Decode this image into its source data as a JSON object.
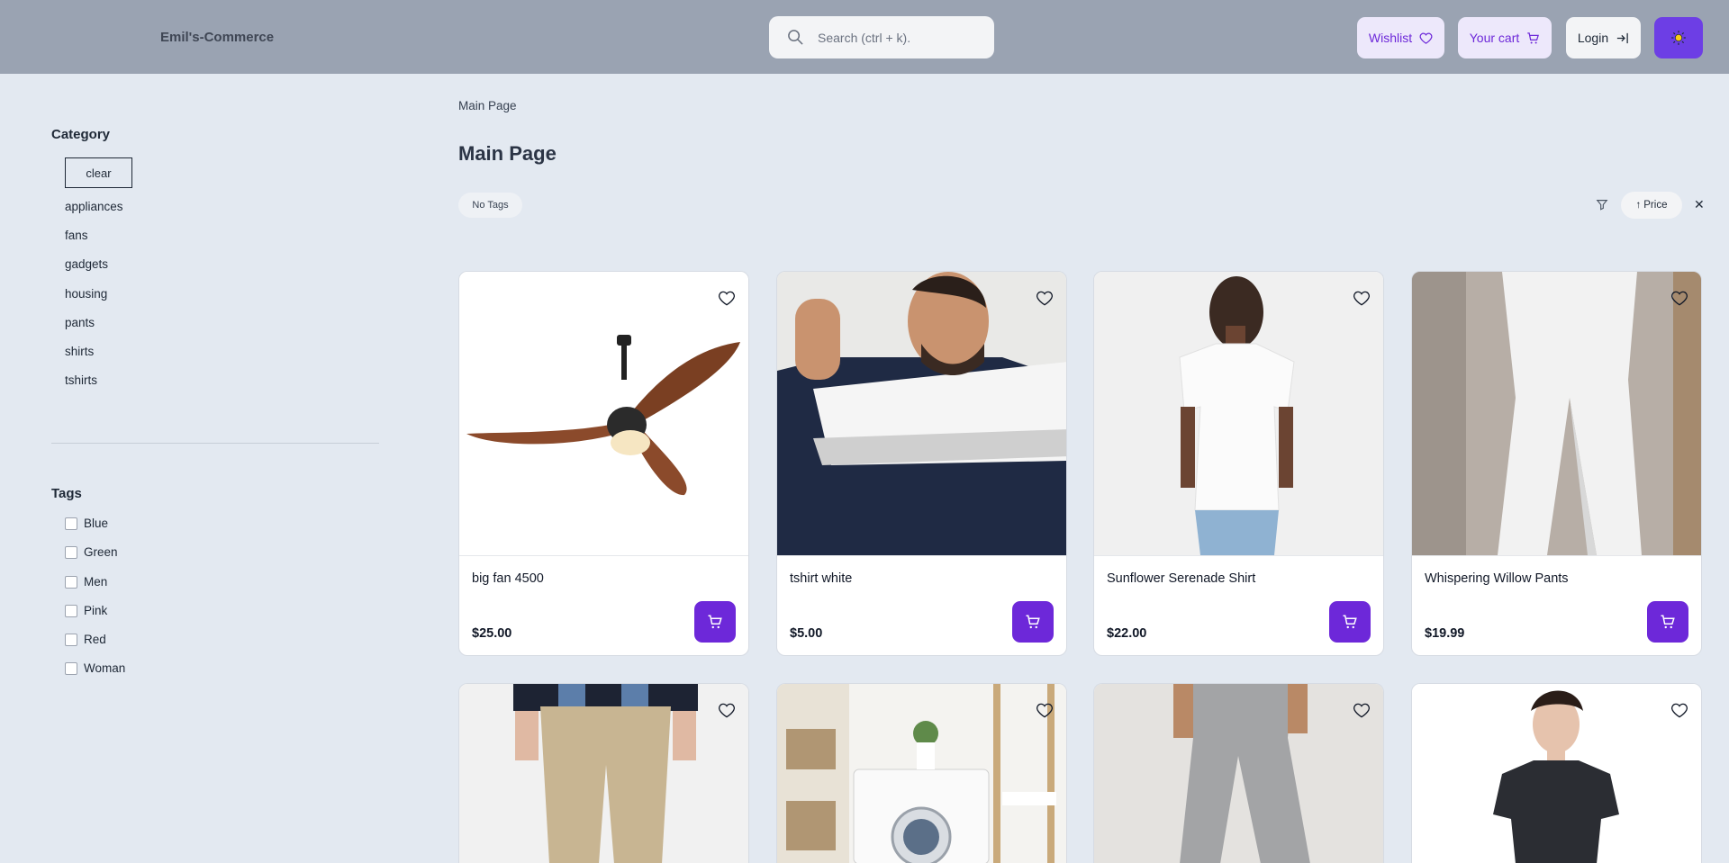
{
  "header": {
    "brand": "Emil's-Commerce",
    "search_placeholder": "Search (ctrl + k).",
    "wishlist_label": "Wishlist",
    "cart_label": "Your cart",
    "login_label": "Login",
    "theme_icon": "sun-icon"
  },
  "sidebar": {
    "category_title": "Category",
    "clear_label": "clear",
    "categories": [
      "appliances",
      "fans",
      "gadgets",
      "housing",
      "pants",
      "shirts",
      "tshirts"
    ],
    "tags_title": "Tags",
    "tags": [
      "Blue",
      "Green",
      "Men",
      "Pink",
      "Red",
      "Woman"
    ]
  },
  "main": {
    "breadcrumb": "Main Page",
    "title": "Main Page",
    "no_tags_label": "No Tags",
    "sort_label": "Price",
    "products": [
      {
        "name": "big fan 4500",
        "price": "$25.00"
      },
      {
        "name": "tshirt white",
        "price": "$5.00"
      },
      {
        "name": "Sunflower Serenade Shirt",
        "price": "$22.00"
      },
      {
        "name": "Whispering Willow Pants",
        "price": "$19.99"
      }
    ]
  },
  "colors": {
    "accent": "#6d28d9",
    "header_bg": "#9aa3b2",
    "page_bg": "#e3e9f1"
  }
}
